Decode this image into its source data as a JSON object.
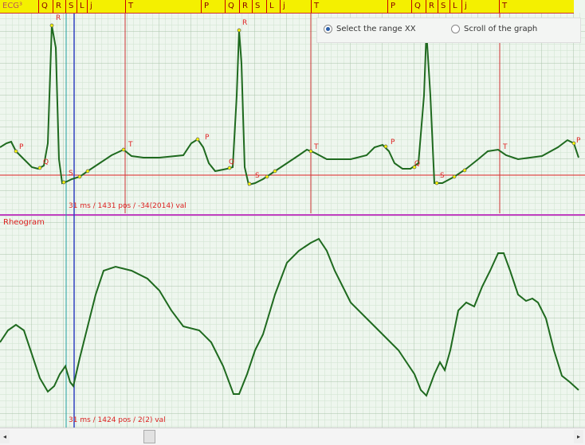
{
  "ecg": {
    "title": "ECG³",
    "cursor_readout": "31 ms / 1431 pos / -34(2014) val",
    "markers": [
      "Q",
      "R",
      "S",
      "L",
      "j",
      "T",
      "P",
      "Q",
      "R",
      "S",
      "L",
      "j",
      "T",
      "P",
      "Q",
      "R",
      "S",
      "L",
      "j",
      "T"
    ],
    "wave_labels": {
      "P": "P",
      "Q": "Q",
      "R": "R",
      "S": "S",
      "T": "T"
    }
  },
  "rheogram": {
    "title": "Rheogram",
    "cursor_readout": "31 ms / 1424 pos / 2(2) val"
  },
  "mode": {
    "options": [
      {
        "label": "Select the range XX",
        "selected": true
      },
      {
        "label": "Scroll of the graph",
        "selected": false
      }
    ]
  },
  "scrollbar": {
    "left_arrow": "◂",
    "right_arrow": "▸"
  },
  "colors": {
    "trace": "#1f6a1f",
    "marker": "#d22",
    "cursor_blue": "#3040c0",
    "cursor_cyan": "#20a0a0",
    "separator": "#c040c0"
  }
}
